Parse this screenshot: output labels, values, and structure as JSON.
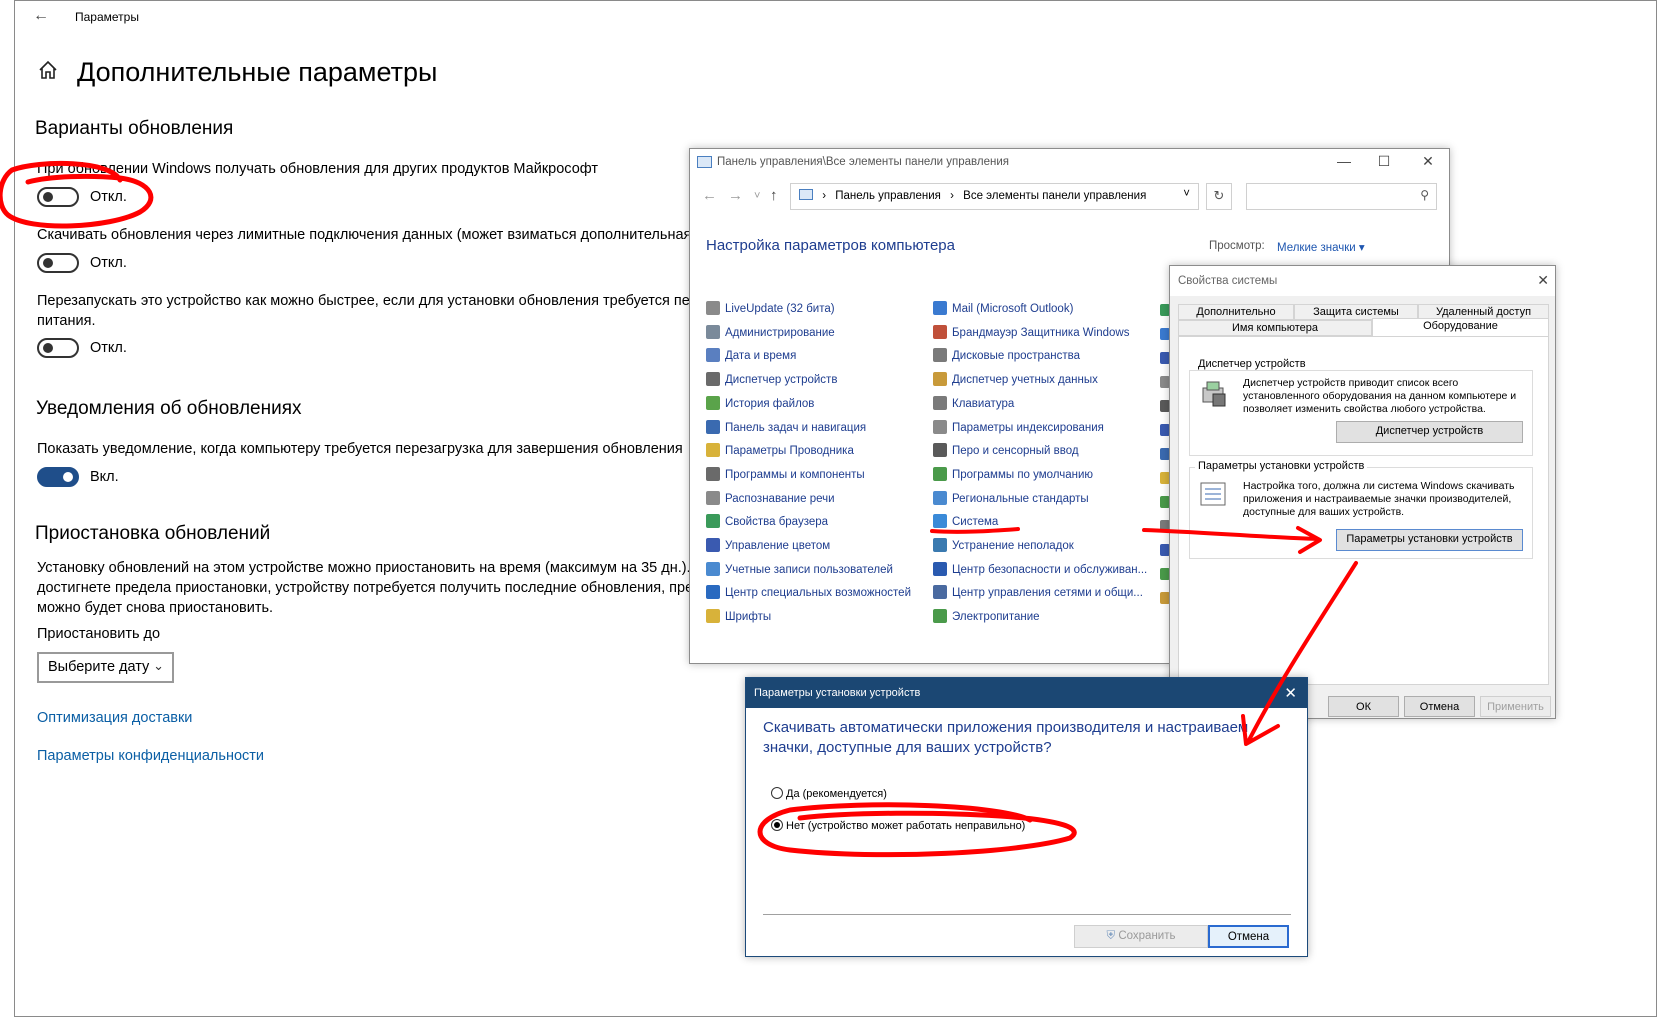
{
  "settings": {
    "back_icon": "back-arrow-icon",
    "app_title": "Параметры",
    "home_icon": "home-icon",
    "page_title": "Дополнительные параметры",
    "section_update_options": "Варианты обновления",
    "opt1_text": "При обновлении Windows получать обновления для других продуктов Майкрософт",
    "opt1_state": "Откл.",
    "opt2_text": "Скачивать обновления через лимитные подключения данных (может взиматься дополнительная пл",
    "opt2_state": "Откл.",
    "opt3_text_line1": "Перезапускать это устройство как можно быстрее, если для установки обновления требуется перез",
    "opt3_text_line2": "питания.",
    "opt3_state": "Откл.",
    "section_notifications": "Уведомления об обновлениях",
    "notify_text": "Показать уведомление, когда компьютеру требуется перезагрузка для завершения обновления",
    "notify_state": "Вкл.",
    "section_pause": "Приостановка обновлений",
    "pause_text_line1": "Установку обновлений на этом устройстве можно приостановить на время (максимум на 35 дн.). Ко",
    "pause_text_line2": "достигнете предела приостановки, устройству потребуется получить последние обновления, прежд",
    "pause_text_line3": "можно будет снова приостановить.",
    "pause_until_label": "Приостановить до",
    "date_select_value": "Выберите дату",
    "link_delivery": "Оптимизация доставки",
    "link_privacy": "Параметры конфиденциальности",
    "toggle_on_color": "#1f4e8a"
  },
  "control_panel": {
    "title": "Панель управления\\Все элементы панели управления",
    "window_buttons": [
      "—",
      "☐",
      "✕"
    ],
    "nav_back": "←",
    "nav_forward": "→",
    "nav_recent": "˅",
    "nav_up": "↑",
    "crumb_1": "Панель управления",
    "crumb_sep": "›",
    "crumb_2": "Все элементы панели управления",
    "address_dropdown": "˅",
    "refresh": "↻",
    "search_icon": "search-icon",
    "heading": "Настройка параметров компьютера",
    "view_label": "Просмотр:",
    "view_value": "Мелкие значки ▾",
    "column1": [
      {
        "label": "LiveUpdate (32 бита)",
        "icon_color": "#8a8a8a"
      },
      {
        "label": "Администрирование",
        "icon_color": "#7a8a9a"
      },
      {
        "label": "Дата и время",
        "icon_color": "#5a7fc0"
      },
      {
        "label": "Диспетчер устройств",
        "icon_color": "#6a6a6a"
      },
      {
        "label": "История файлов",
        "icon_color": "#5aa34a"
      },
      {
        "label": "Панель задач и навигация",
        "icon_color": "#3a6ab0"
      },
      {
        "label": "Параметры Проводника",
        "icon_color": "#d8b23a"
      },
      {
        "label": "Программы и компоненты",
        "icon_color": "#6a6a6a"
      },
      {
        "label": "Распознавание речи",
        "icon_color": "#8a8a8a"
      },
      {
        "label": "Свойства браузера",
        "icon_color": "#3a9a5a"
      },
      {
        "label": "Управление цветом",
        "icon_color": "#3a5ab0"
      },
      {
        "label": "Учетные записи пользователей",
        "icon_color": "#4a8ad0"
      },
      {
        "label": "Центр специальных возможностей",
        "icon_color": "#2a6ac0"
      },
      {
        "label": "Шрифты",
        "icon_color": "#d8b23a"
      }
    ],
    "column2": [
      {
        "label": "Mail (Microsoft Outlook)",
        "icon_color": "#3a7ad0"
      },
      {
        "label": "Брандмауэр Защитника Windows",
        "icon_color": "#c0503a"
      },
      {
        "label": "Дисковые пространства",
        "icon_color": "#7a7a7a"
      },
      {
        "label": "Диспетчер учетных данных",
        "icon_color": "#c89a3a"
      },
      {
        "label": "Клавиатура",
        "icon_color": "#7a7a7a"
      },
      {
        "label": "Параметры индексирования",
        "icon_color": "#8a8a8a"
      },
      {
        "label": "Перо и сенсорный ввод",
        "icon_color": "#5a5a5a"
      },
      {
        "label": "Программы по умолчанию",
        "icon_color": "#4a9a4a"
      },
      {
        "label": "Региональные стандарты",
        "icon_color": "#4a8ad0"
      },
      {
        "label": "Система",
        "icon_color": "#3a8ad8"
      },
      {
        "label": "Устранение неполадок",
        "icon_color": "#3a7ab0"
      },
      {
        "label": "Центр безопасности и обслуживан...",
        "icon_color": "#2a5ab0"
      },
      {
        "label": "Центр управления сетями и общи...",
        "icon_color": "#4a6aa0"
      },
      {
        "label": "Электропитание",
        "icon_color": "#4a9a4a"
      }
    ]
  },
  "system_properties": {
    "title": "Свойства системы",
    "close": "✕",
    "tabs_row1": [
      "Дополнительно",
      "Защита системы",
      "Удаленный доступ"
    ],
    "tabs_row2": [
      "Имя компьютера",
      "Оборудование"
    ],
    "selected_tab": "Оборудование",
    "group1_title": "Диспетчер устройств",
    "group1_desc": "Диспетчер устройств приводит список всего установленного оборудования на данном компьютере и позволяет изменить свойства любого устройства.",
    "group1_button": "Диспетчер устройств",
    "group2_title": "Параметры установки устройств",
    "group2_desc": "Настройка того, должна ли система Windows скачивать приложения и настраиваемые значки производителей, доступные для ваших устройств.",
    "group2_button": "Параметры установки устройств",
    "ok": "ОК",
    "cancel": "Отмена",
    "apply": "Применить"
  },
  "device_install_dialog": {
    "title": "Параметры установки устройств",
    "close": "✕",
    "question_line1": "Скачивать автоматически приложения производителя и настраиваем",
    "question_line2": "значки, доступные для ваших устройств?",
    "option_yes": "Да (рекомендуется)",
    "option_no": "Нет (устройство может работать неправильно)",
    "selected": "option_no",
    "save": "Сохранить",
    "cancel": "Отмена",
    "title_bar_color": "#1b4773"
  },
  "annotation_color": "#ff0000"
}
